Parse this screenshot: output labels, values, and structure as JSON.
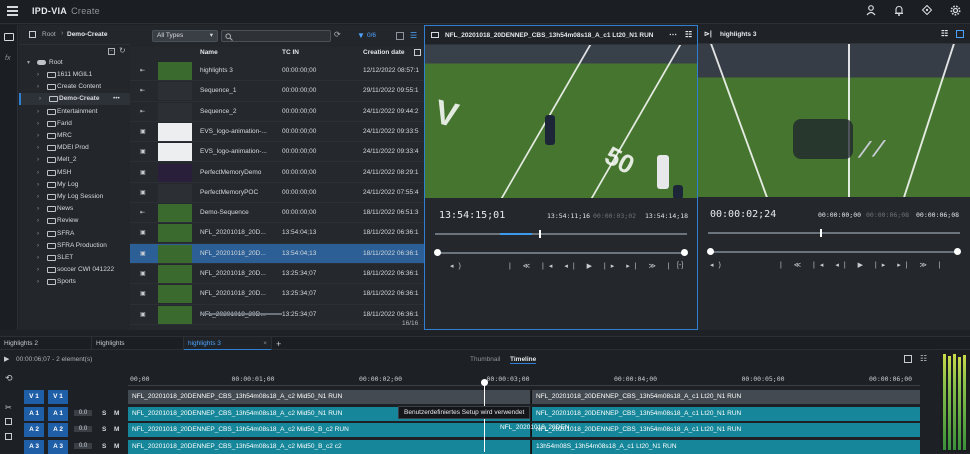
{
  "app": {
    "name": "IPD-VIA",
    "subtitle": "Create"
  },
  "topbar": {
    "icons": [
      "user-icon",
      "bell-icon",
      "compass-icon",
      "gear-icon"
    ]
  },
  "breadcrumb": {
    "root": "Root",
    "current": "Demo-Create"
  },
  "tree": {
    "root": "Root",
    "items": [
      {
        "label": "1611 MGIL1"
      },
      {
        "label": "Create Content"
      },
      {
        "label": "Demo-Create",
        "selected": true,
        "menu": "•••"
      },
      {
        "label": "Entertainment"
      },
      {
        "label": "Farid"
      },
      {
        "label": "MRC"
      },
      {
        "label": "MDEI Prod"
      },
      {
        "label": "Melt_2"
      },
      {
        "label": "MSH"
      },
      {
        "label": "My Log"
      },
      {
        "label": "My Log Session"
      },
      {
        "label": "News"
      },
      {
        "label": "Review"
      },
      {
        "label": "SFRA"
      },
      {
        "label": "SFRA Production"
      },
      {
        "label": "SLET"
      },
      {
        "label": "soccer CWI 041222"
      },
      {
        "label": "Sports"
      }
    ]
  },
  "files": {
    "filter": {
      "type_select": "All Types",
      "search_placeholder": "",
      "count": "0/6"
    },
    "columns": {
      "name": "Name",
      "tc_in": "TC IN",
      "created": "Creation date"
    },
    "rows": [
      {
        "name": "highlights 3",
        "tc_in": "00:00:00;00",
        "created": "12/12/2022 08:57:1"
      },
      {
        "name": "Sequence_1",
        "tc_in": "00:00:00;00",
        "created": "29/11/2022 09:55:1"
      },
      {
        "name": "Sequence_2",
        "tc_in": "00:00:00;00",
        "created": "24/11/2022 09:44:2"
      },
      {
        "name": "EVS_logo-animation-...",
        "tc_in": "00:00:00;00",
        "created": "24/11/2022 09:33:5"
      },
      {
        "name": "EVS_logo-animation-...",
        "tc_in": "00:00:00;00",
        "created": "24/11/2022 09:33:4"
      },
      {
        "name": "PerfectMemoryDemo",
        "tc_in": "00:00:00;00",
        "created": "24/11/2022 08:29:1"
      },
      {
        "name": "PerfectMemoryPOC",
        "tc_in": "00:00:00;00",
        "created": "24/11/2022 07:55:4"
      },
      {
        "name": "Demo-Sequence",
        "tc_in": "00:00:00;00",
        "created": "18/11/2022 06:51:3"
      },
      {
        "name": "NFL_20201018_20D...",
        "tc_in": "13:54:04;13",
        "created": "18/11/2022 06:36:1"
      },
      {
        "name": "NFL_20201018_20D...",
        "tc_in": "13:54:04;13",
        "created": "18/11/2022 06:36:1",
        "selected": true
      },
      {
        "name": "NFL_20201018_20D...",
        "tc_in": "13:25:34;07",
        "created": "18/11/2022 06:36:1"
      },
      {
        "name": "NFL_20201018_20D...",
        "tc_in": "13:25:34;07",
        "created": "18/11/2022 06:36:1"
      },
      {
        "name": "NFL_20201018_20D...",
        "tc_in": "13:25:34;07",
        "created": "18/11/2022 06:36:1"
      }
    ],
    "footer_count": "16/16"
  },
  "viewer_left": {
    "title": "NFL_20201018_20DENNEP_CBS_13h54m08s18_A_c1 Lt20_N1 RUN",
    "tc_current": "13:54:15;01",
    "tc_in": "13:54:11;16",
    "tc_mid": "00:00:03;02",
    "tc_out": "13:54:14;18",
    "field_numbers": "50"
  },
  "viewer_right": {
    "title": "highlights 3",
    "tc_current": "00:00:02;24",
    "tc_in": "00:00:00;00",
    "tc_mid": "00:00:06;08",
    "tc_out": "00:00:06;08"
  },
  "tabs": [
    {
      "label": "Highlights 2"
    },
    {
      "label": "Highlights"
    },
    {
      "label": "highlights 3",
      "active": true
    }
  ],
  "timeline": {
    "info": "00:00:06;07 - 2 element(s)",
    "modes": {
      "thumbnail": "Thumbnail",
      "timeline": "Timeline"
    },
    "ruler": [
      "00;00",
      "00:00:01;00",
      "00:00:02;00",
      "00:00:03;00",
      "00:00:04;00",
      "00:00:05;00",
      "00:00:06;00"
    ],
    "tracks": [
      {
        "a": "V 1",
        "b": "V 1",
        "gain": "",
        "clip1": "NFL_20201018_20DENNEP_CBS_13h54m08s18_A_c2 Mid50_N1 RUN",
        "clip2": "NFL_20201018_20DENNEP_CBS_13h54m08s18_A_c1 Lt20_N1 RUN"
      },
      {
        "a": "A 1",
        "b": "A 1",
        "gain": "0.0",
        "s": "S",
        "m": "M",
        "clip1": "NFL_20201018_20DENNEP_CBS_13h54m08s18_A_c2 Mid50_N1 RUN",
        "clip2": "NFL_20201018_20DENNEP_CBS_13h54m08s18_A_c1 Lt20_N1 RUN"
      },
      {
        "a": "A 2",
        "b": "A 2",
        "gain": "0.0",
        "s": "S",
        "m": "M",
        "clip1": "NFL_20201018_20DENNEP_CBS_13h54m08s18_A_c2 Mid50_B_c2 RUN",
        "clip2": "NFL_20201018_20DENNEP_CBS_13h54m08s18_A_c1 Lt20_N1 RUN"
      },
      {
        "a": "A 3",
        "b": "A 3",
        "gain": "0.0",
        "s": "S",
        "m": "M",
        "clip1": "NFL_20201018_20DENNEP_CBS_13h54m08s18_A_c2 Mid50_B_c2 c2",
        "clip2": "13h54m08S_13h54m08s18_A_c1 Lt20_N1 RUN"
      }
    ],
    "tooltip": "Benutzerdefiniertes Setup wird verwendet",
    "overlap_label": "NFL_20201018_20DEN"
  }
}
